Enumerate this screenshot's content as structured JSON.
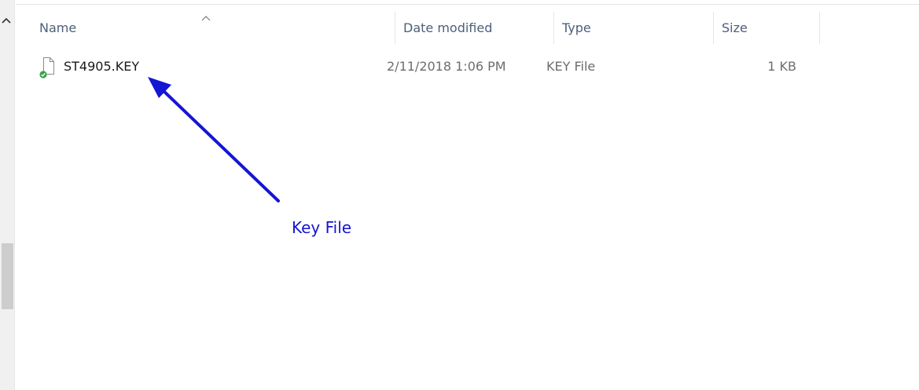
{
  "columns": {
    "name": "Name",
    "date_modified": "Date modified",
    "type": "Type",
    "size": "Size"
  },
  "sort": {
    "column": "name",
    "direction": "ascending",
    "icon": "chevron-up-icon"
  },
  "files": [
    {
      "name": "ST4905.KEY",
      "date_modified": "2/11/2018 1:06 PM",
      "type": "KEY File",
      "size": "1 KB",
      "icon": "file-icon",
      "sync_status": "synced",
      "sync_icon": "checkmark-badge-icon"
    }
  ],
  "annotation": {
    "label": "Key File",
    "color": "#1515d4"
  },
  "colors": {
    "header_text": "#4c607a",
    "row_text": "#6d6d6d",
    "name_text": "#1a1a1a",
    "sync_green": "#3aa34a"
  }
}
